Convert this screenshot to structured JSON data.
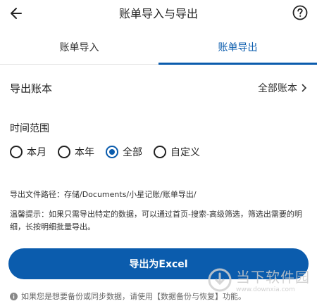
{
  "header": {
    "title": "账单导入与导出",
    "back_icon": "arrow-left-icon",
    "help_icon": "help-circle-icon"
  },
  "tabs": [
    {
      "label": "账单导入",
      "active": false
    },
    {
      "label": "账单导出",
      "active": true
    }
  ],
  "account_row": {
    "label": "导出账本",
    "value": "全部账本"
  },
  "time_range": {
    "label": "时间范围",
    "options": [
      "本月",
      "本年",
      "全部",
      "自定义"
    ],
    "selected": "全部"
  },
  "export_path": "导出文件路径：存储/Documents/小星记账/账单导出/",
  "tip": "温馨提示：如果只需导出特定的数据，可以通过首页-搜索-高级筛选，筛选出需要的明细，长按明细批量导出。",
  "export_button": "导出为Excel",
  "footnote": "如果您是想要备份或同步数据，请使用【数据备份与恢复】功能。",
  "watermark": {
    "cn": "当下软件园",
    "url": "www.downxia.com"
  },
  "colors": {
    "accent": "#0b5cad",
    "text": "#222222"
  }
}
